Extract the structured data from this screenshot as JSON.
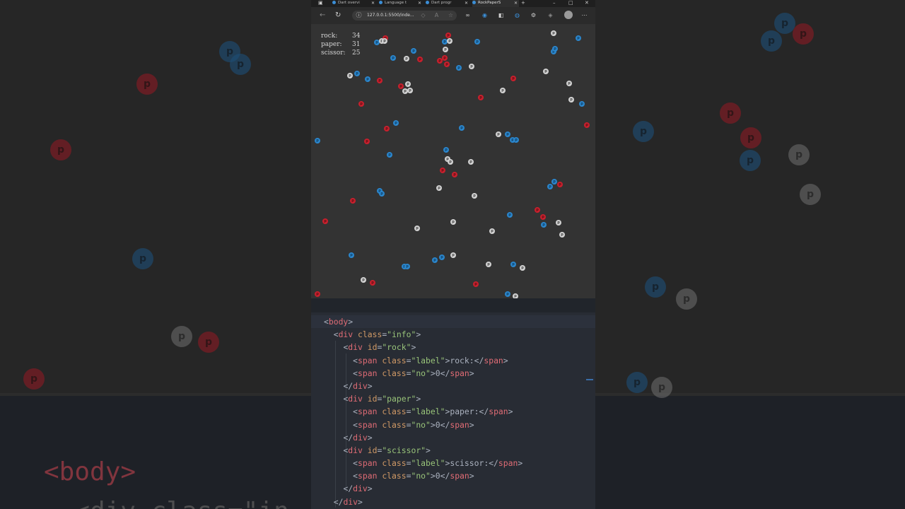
{
  "browser": {
    "tabs": [
      {
        "label": "Dart overvi",
        "active": false
      },
      {
        "label": "Language t",
        "active": false
      },
      {
        "label": "Dart progr",
        "active": false
      },
      {
        "label": "RockPaperS",
        "active": true
      }
    ],
    "url": "127.0.0.1:5500/inde...",
    "icons": [
      "back-icon",
      "reload-icon",
      "info-icon",
      "read-aloud-icon",
      "favorite-icon",
      "extensions-icon",
      "collections-icon",
      "split-screen-icon",
      "edge-icon",
      "copilot-icon",
      "settings-icon",
      "profile-icon",
      "more-icon"
    ]
  },
  "scoreboard": {
    "rock_label": "rock:",
    "rock_count": "34",
    "paper_label": "paper:",
    "paper_count": "31",
    "scissor_label": "scissor:",
    "scissor_count": "25"
  },
  "particle_glyph": "p",
  "editor": {
    "lines": [
      {
        "indent": 0,
        "tokens": [
          [
            "pn",
            "<"
          ],
          [
            "tg",
            "body"
          ],
          [
            "pn",
            ">"
          ]
        ]
      },
      {
        "indent": 1,
        "tokens": [
          [
            "pn",
            "<"
          ],
          [
            "tg",
            "div"
          ],
          [
            "pn",
            " "
          ],
          [
            "at",
            "class"
          ],
          [
            "pn",
            "="
          ],
          [
            "st",
            "\"info\""
          ],
          [
            "pn",
            ">"
          ]
        ]
      },
      {
        "indent": 2,
        "tokens": [
          [
            "pn",
            "<"
          ],
          [
            "tg",
            "div"
          ],
          [
            "pn",
            " "
          ],
          [
            "at",
            "id"
          ],
          [
            "pn",
            "="
          ],
          [
            "st",
            "\"rock\""
          ],
          [
            "pn",
            ">"
          ]
        ]
      },
      {
        "indent": 3,
        "tokens": [
          [
            "pn",
            "<"
          ],
          [
            "tg",
            "span"
          ],
          [
            "pn",
            " "
          ],
          [
            "at",
            "class"
          ],
          [
            "pn",
            "="
          ],
          [
            "st",
            "\"label\""
          ],
          [
            "pn",
            ">rock:</"
          ],
          [
            "tg",
            "span"
          ],
          [
            "pn",
            ">"
          ]
        ]
      },
      {
        "indent": 3,
        "tokens": [
          [
            "pn",
            "<"
          ],
          [
            "tg",
            "span"
          ],
          [
            "pn",
            " "
          ],
          [
            "at",
            "class"
          ],
          [
            "pn",
            "="
          ],
          [
            "st",
            "\"no\""
          ],
          [
            "pn",
            ">0</"
          ],
          [
            "tg",
            "span"
          ],
          [
            "pn",
            ">"
          ]
        ]
      },
      {
        "indent": 2,
        "tokens": [
          [
            "pn",
            "</"
          ],
          [
            "tg",
            "div"
          ],
          [
            "pn",
            ">"
          ]
        ]
      },
      {
        "indent": 2,
        "tokens": [
          [
            "pn",
            "<"
          ],
          [
            "tg",
            "div"
          ],
          [
            "pn",
            " "
          ],
          [
            "at",
            "id"
          ],
          [
            "pn",
            "="
          ],
          [
            "st",
            "\"paper\""
          ],
          [
            "pn",
            ">"
          ]
        ]
      },
      {
        "indent": 3,
        "tokens": [
          [
            "pn",
            "<"
          ],
          [
            "tg",
            "span"
          ],
          [
            "pn",
            " "
          ],
          [
            "at",
            "class"
          ],
          [
            "pn",
            "="
          ],
          [
            "st",
            "\"label\""
          ],
          [
            "pn",
            ">paper:</"
          ],
          [
            "tg",
            "span"
          ],
          [
            "pn",
            ">"
          ]
        ]
      },
      {
        "indent": 3,
        "tokens": [
          [
            "pn",
            "<"
          ],
          [
            "tg",
            "span"
          ],
          [
            "pn",
            " "
          ],
          [
            "at",
            "class"
          ],
          [
            "pn",
            "="
          ],
          [
            "st",
            "\"no\""
          ],
          [
            "pn",
            ">0</"
          ],
          [
            "tg",
            "span"
          ],
          [
            "pn",
            ">"
          ]
        ]
      },
      {
        "indent": 2,
        "tokens": [
          [
            "pn",
            "</"
          ],
          [
            "tg",
            "div"
          ],
          [
            "pn",
            ">"
          ]
        ]
      },
      {
        "indent": 2,
        "tokens": [
          [
            "pn",
            "<"
          ],
          [
            "tg",
            "div"
          ],
          [
            "pn",
            " "
          ],
          [
            "at",
            "id"
          ],
          [
            "pn",
            "="
          ],
          [
            "st",
            "\"scissor\""
          ],
          [
            "pn",
            ">"
          ]
        ]
      },
      {
        "indent": 3,
        "tokens": [
          [
            "pn",
            "<"
          ],
          [
            "tg",
            "span"
          ],
          [
            "pn",
            " "
          ],
          [
            "at",
            "class"
          ],
          [
            "pn",
            "="
          ],
          [
            "st",
            "\"label\""
          ],
          [
            "pn",
            ">scissor:</"
          ],
          [
            "tg",
            "span"
          ],
          [
            "pn",
            ">"
          ]
        ]
      },
      {
        "indent": 3,
        "tokens": [
          [
            "pn",
            "<"
          ],
          [
            "tg",
            "span"
          ],
          [
            "pn",
            " "
          ],
          [
            "at",
            "class"
          ],
          [
            "pn",
            "="
          ],
          [
            "st",
            "\"no\""
          ],
          [
            "pn",
            ">0</"
          ],
          [
            "tg",
            "span"
          ],
          [
            "pn",
            ">"
          ]
        ]
      },
      {
        "indent": 2,
        "tokens": [
          [
            "pn",
            "</"
          ],
          [
            "tg",
            "div"
          ],
          [
            "pn",
            ">"
          ]
        ]
      },
      {
        "indent": 1,
        "tokens": [
          [
            "pn",
            "</"
          ],
          [
            "tg",
            "div"
          ],
          [
            "pn",
            ">"
          ]
        ]
      }
    ]
  },
  "colors": {
    "rock": "#c8202d",
    "paper": "#d2d2d2",
    "scissor": "#2b86cc",
    "sim_background": "#333333",
    "editor_background": "#282c34"
  },
  "background_code_text": [
    "<body>",
    "  <div class=\"in"
  ]
}
